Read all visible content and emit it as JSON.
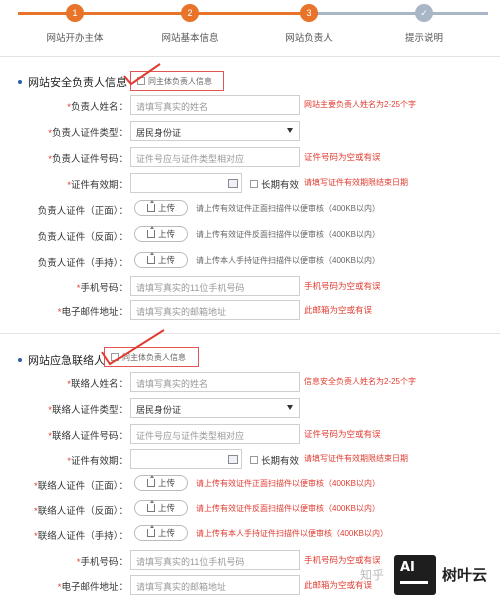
{
  "steps": [
    {
      "num": "1",
      "label": "网站开办主体",
      "state": "done"
    },
    {
      "num": "2",
      "label": "网站基本信息",
      "state": "done"
    },
    {
      "num": "3",
      "label": "网站负责人",
      "state": "current"
    },
    {
      "num": "✓",
      "label": "提示说明",
      "state": "todo"
    }
  ],
  "colors": {
    "accent": "#e8742a",
    "todo": "#a9b6c6",
    "required": "#e03c31"
  },
  "section1": {
    "title": "网站安全负责人信息",
    "same_label": "同主体负责人信息",
    "fields": {
      "name": {
        "label": "负责人姓名：",
        "placeholder": "请填写真实的姓名",
        "hint": "网站主要负责人姓名为2-25个字"
      },
      "id_type": {
        "label": "负责人证件类型：",
        "value": "居民身份证"
      },
      "id_number": {
        "label": "负责人证件号码：",
        "placeholder": "证件号应与证件类型相对应",
        "hint": "证件号码为空或有误"
      },
      "validity": {
        "label": "证件有效期：",
        "longterm": "长期有效",
        "hint": "请填写证件有效期限结束日期"
      },
      "front": {
        "label": "负责人证件（正面）：",
        "button": "上传",
        "hint": "请上传有效证件正面扫描件以便审核（400KB以内）"
      },
      "back": {
        "label": "负责人证件（反面）：",
        "button": "上传",
        "hint": "请上传有效证件反面扫描件以便审核（400KB以内）"
      },
      "hold": {
        "label": "负责人证件（手持）：",
        "button": "上传",
        "hint": "请上传本人手持证件扫描件以便审核（400KB以内）"
      },
      "phone": {
        "label": "手机号码：",
        "placeholder": "请填写真实的11位手机号码",
        "hint": "手机号码为空或有误"
      },
      "email": {
        "label": "电子邮件地址：",
        "placeholder": "请填写真实的邮箱地址",
        "hint": "此邮箱为空或有误"
      }
    }
  },
  "section2": {
    "title": "网站应急联络人",
    "same_label": "同主体负责人信息",
    "fields": {
      "name": {
        "label": "联络人姓名：",
        "placeholder": "请填写真实的姓名",
        "hint": "信息安全负责人姓名为2-25个字"
      },
      "id_type": {
        "label": "联络人证件类型：",
        "value": "居民身份证"
      },
      "id_number": {
        "label": "联络人证件号码：",
        "placeholder": "证件号应与证件类型相对应",
        "hint": "证件号码为空或有误"
      },
      "validity": {
        "label": "证件有效期：",
        "longterm": "长期有效",
        "hint": "请填写证件有效期限结束日期"
      },
      "front": {
        "label": "联络人证件（正面）：",
        "button": "上传",
        "hint": "请上传有效证件正面扫描件以便审核（400KB以内）"
      },
      "back": {
        "label": "联络人证件（反面）：",
        "button": "上传",
        "hint": "请上传有效证件反面扫描件以便审核（400KB以内）"
      },
      "hold": {
        "label": "联络人证件（手持）：",
        "button": "上传",
        "hint": "请上传有本人手持证件扫描件以便审核（400KB以内）"
      },
      "phone": {
        "label": "手机号码：",
        "placeholder": "请填写真实的11位手机号码",
        "hint": "手机号码为空或有误"
      },
      "email": {
        "label": "电子邮件地址：",
        "placeholder": "请填写真实的邮箱地址",
        "hint": "此邮箱为空或有误"
      }
    }
  },
  "watermark": {
    "zhihu": "知乎",
    "logo_text": "AI",
    "brand": "树叶云"
  }
}
